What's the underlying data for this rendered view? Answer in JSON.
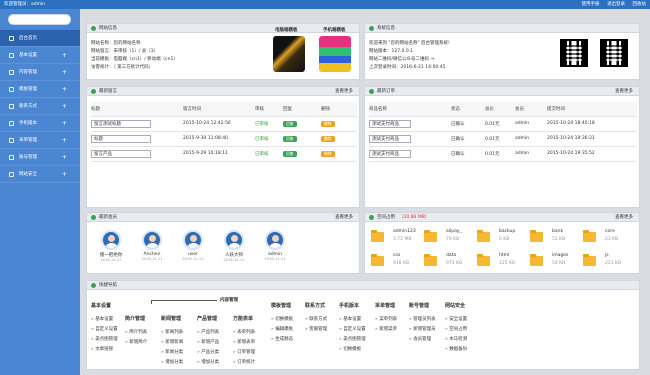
{
  "topbar": {
    "welcome": "欢迎管理员：admin",
    "links": [
      "使用手册",
      "退出登录",
      "回收站"
    ]
  },
  "sidebar": {
    "items": [
      {
        "label": "后台首页",
        "active": true
      },
      {
        "label": "基本设置"
      },
      {
        "label": "内容管理"
      },
      {
        "label": "模板管理"
      },
      {
        "label": "联系方式"
      },
      {
        "label": "手机版本"
      },
      {
        "label": "采单管理"
      },
      {
        "label": "账号管理"
      },
      {
        "label": "网站安全"
      }
    ]
  },
  "site": {
    "title": "网站信息",
    "lines": [
      "网站名称：您的网站名称",
      "网站留言：未审核（1）/ 总（3）",
      "当前模板：电脑端（cn1）/ 移动端（cn1）",
      "访客统计：（ 第三方统计代码）"
    ],
    "thumb1": "电脑端模板",
    "thumb2": "手机端模板"
  },
  "sys": {
    "title": "系统信息",
    "lines": [
      "欢迎来到 \"您的网站名称\" 后台管理系统!",
      "网站版本：127.0.0.1",
      "网站二维码/微信公众号二维码 →",
      "上次登录时间：2016-6-21 14:00:45"
    ]
  },
  "msgs": {
    "title": "最新留言",
    "more": "查看更多",
    "headers": [
      "标题",
      "留言时间",
      "审核",
      "回复",
      "删除"
    ],
    "rows": [
      {
        "title": "留言测试标题",
        "time": "2015-10-24 12:42:56",
        "status": "已审核",
        "reply": "回复",
        "del": "删除"
      },
      {
        "title": "标题",
        "time": "2015-9-30 11:08:40",
        "status": "已审核",
        "reply": "回复",
        "del": "删除"
      },
      {
        "title": "留言产品",
        "time": "2015-9-29 10:18:11",
        "status": "已审核",
        "reply": "回复",
        "del": "删除"
      }
    ]
  },
  "orders": {
    "title": "最新订单",
    "more": "查看更多",
    "headers": [
      "商品名称",
      "状态",
      "总价",
      "会员",
      "提交时间"
    ],
    "rows": [
      {
        "name": "测试支付商品",
        "status": "已确认",
        "price": "0.01元",
        "member": "admin",
        "time": "2015-10-24 18:40:18"
      },
      {
        "name": "测试支付商品",
        "status": "已确认",
        "price": "0.01元",
        "member": "admin",
        "time": "2015-10-24 19:36:21"
      },
      {
        "name": "测试支付商品",
        "status": "已确认",
        "price": "0.01元",
        "member": "admin",
        "time": "2015-10-24 19:35:52"
      }
    ]
  },
  "members": {
    "title": "最新会员",
    "more": "查看更多",
    "items": [
      {
        "name": "猪一把绝你",
        "date": "2016-11-11"
      },
      {
        "name": "Anchen",
        "date": "2016-11-11"
      },
      {
        "name": "user",
        "date": "2016-11-11"
      },
      {
        "name": "人妖大师",
        "date": "2016-11-11"
      },
      {
        "name": "admin",
        "date": "2016-11-11"
      }
    ]
  },
  "space": {
    "title": "空间占用",
    "used": "（10.86 MB）",
    "more": "查看更多",
    "folders": [
      {
        "name": "admin123",
        "size": "3.72 MB"
      },
      {
        "name": "alipay_",
        "size": "79 KB"
      },
      {
        "name": "backup",
        "size": "0 KB"
      },
      {
        "name": "bank",
        "size": "51 KB"
      },
      {
        "name": "core",
        "size": "23 KB"
      },
      {
        "name": "css",
        "size": "918 KB"
      },
      {
        "name": "data",
        "size": "975 KB"
      },
      {
        "name": "html",
        "size": "125 KB"
      },
      {
        "name": "images",
        "size": "54 KB"
      },
      {
        "name": "js",
        "size": "221 KB"
      }
    ]
  },
  "quick": {
    "title": "快捷导航",
    "content_label": "内容管理",
    "cols": [
      {
        "head": "基本设置",
        "items": [
          "基本设置",
          "自定义设置",
          "美点图管理",
          "文章链接"
        ]
      },
      {
        "head": "简介管理",
        "items": [
          "简介列表",
          "新增简介"
        ]
      },
      {
        "head": "新闻管理",
        "items": [
          "新闻列表",
          "新增新闻",
          "新闻分类",
          "增加分类"
        ]
      },
      {
        "head": "产品管理",
        "items": [
          "产品列表",
          "新增产品",
          "产品分类",
          "增加分类"
        ]
      },
      {
        "head": "万能表单",
        "items": [
          "表单列表",
          "新增表单",
          "订单管理",
          "订单统计"
        ]
      },
      {
        "head": "模板管理",
        "items": [
          "切换模板",
          "编辑模板",
          "生成静态"
        ]
      },
      {
        "head": "联系方式",
        "items": [
          "联系方式",
          "客服管理"
        ]
      },
      {
        "head": "手机版本",
        "items": [
          "基本设置",
          "自定义设置",
          "美点图管理",
          "切换模板"
        ]
      },
      {
        "head": "采单管理",
        "items": [
          "菜单列表",
          "新增菜单"
        ]
      },
      {
        "head": "账号管理",
        "items": [
          "管理员列表",
          "新增管理员",
          "会员管理"
        ]
      },
      {
        "head": "网站安全",
        "items": [
          "安全设置",
          "空间占用",
          "木马检测",
          "数据备份"
        ]
      }
    ]
  }
}
